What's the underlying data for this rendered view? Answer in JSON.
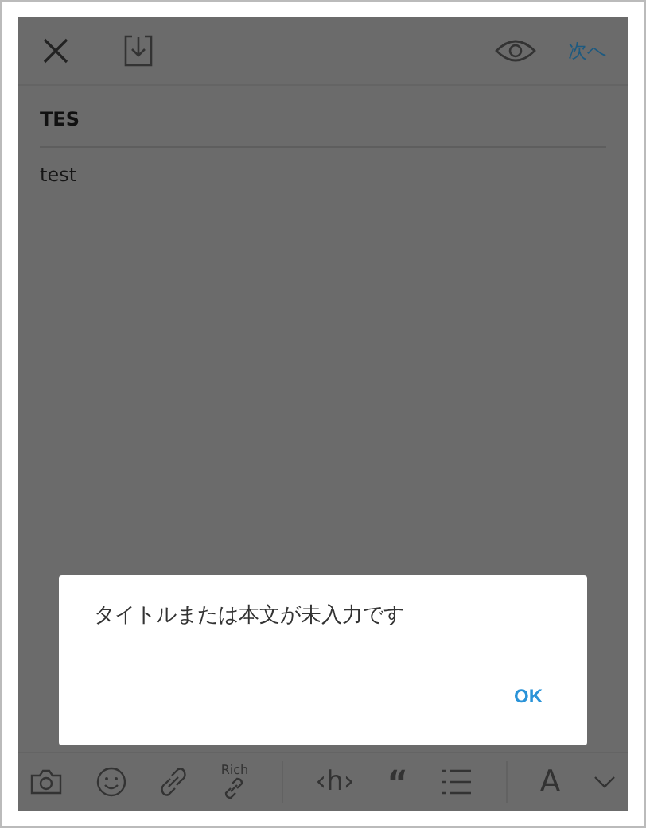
{
  "top_bar": {
    "next": "次へ"
  },
  "note": {
    "title": "TES",
    "body": "test"
  },
  "dialog": {
    "message": "タイトルまたは本文が未入力です",
    "button": "OK"
  },
  "toolbar": [
    {
      "kind": "camera"
    },
    {
      "kind": "emoji"
    },
    {
      "kind": "link"
    },
    {
      "kind": "rich-link",
      "label": "Rich"
    },
    {
      "kind": "heading",
      "label": "‹h›"
    },
    {
      "kind": "quote",
      "label": "“"
    },
    {
      "kind": "list"
    },
    {
      "kind": "font",
      "label": "A"
    },
    {
      "kind": "chevron"
    }
  ]
}
